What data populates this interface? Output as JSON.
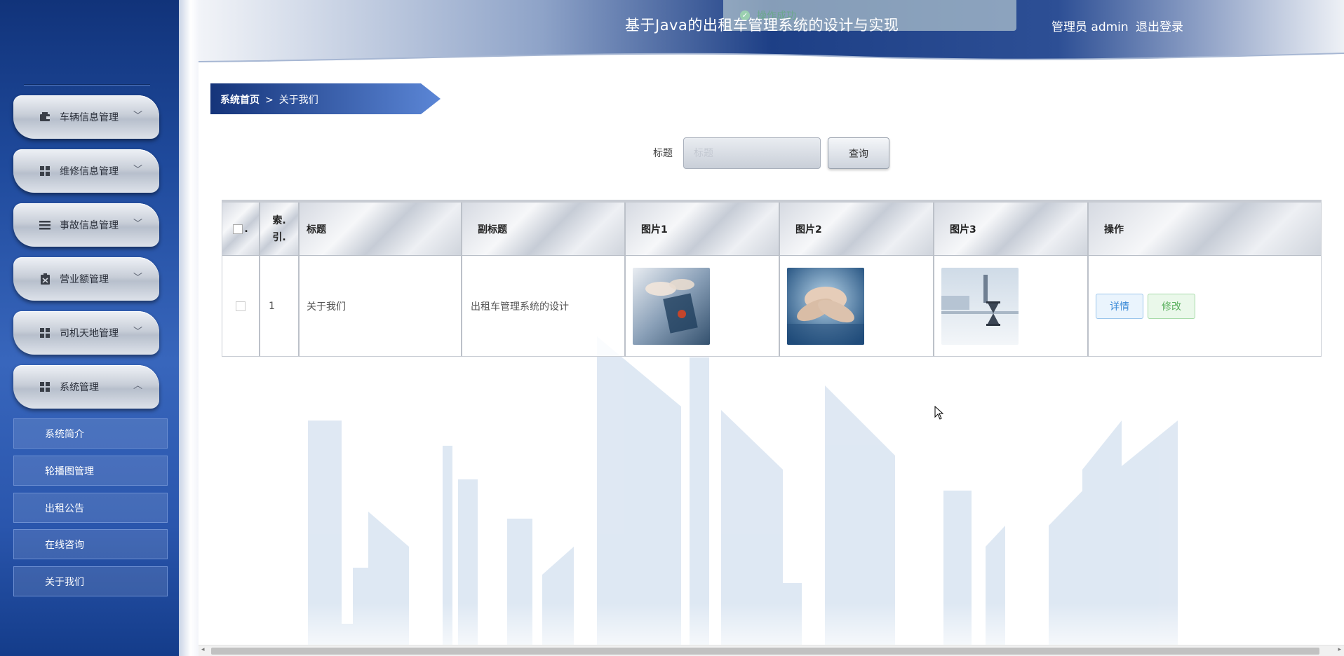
{
  "sidebar": {
    "menus": [
      {
        "label": "车辆信息管理",
        "icon": "wallet-icon",
        "expanded": false
      },
      {
        "label": "维修信息管理",
        "icon": "grid-icon",
        "expanded": false
      },
      {
        "label": "事故信息管理",
        "icon": "list-icon",
        "expanded": false
      },
      {
        "label": "营业额管理",
        "icon": "clipboard-icon",
        "expanded": false
      },
      {
        "label": "司机天地管理",
        "icon": "grid-icon",
        "expanded": false
      },
      {
        "label": "系统管理",
        "icon": "grid-icon",
        "expanded": true
      }
    ],
    "submenu": [
      "系统简介",
      "轮播图管理",
      "出租公告",
      "在线咨询",
      "关于我们"
    ]
  },
  "header": {
    "title": "基于Java的出租车管理系统的设计与实现",
    "user": "管理员 admin",
    "logout": "退出登录",
    "toast": "操作成功"
  },
  "breadcrumb": {
    "home": "系统首页",
    "separator": ">",
    "current": "关于我们"
  },
  "search": {
    "label": "标题",
    "placeholder": "标题",
    "button": "查询"
  },
  "table": {
    "headers": [
      "索引",
      "标题",
      "副标题",
      "图片1",
      "图片2",
      "图片3",
      "操作"
    ],
    "index_header_top": "索.",
    "index_header_bottom": "引.",
    "rows": [
      {
        "index": "1",
        "title": "关于我们",
        "subtitle": "出租车管理系统的设计",
        "detail": "详情",
        "edit": "修改"
      }
    ]
  },
  "colors": {
    "accent": "#1f4a9c",
    "header_dark": "#143c8a"
  }
}
